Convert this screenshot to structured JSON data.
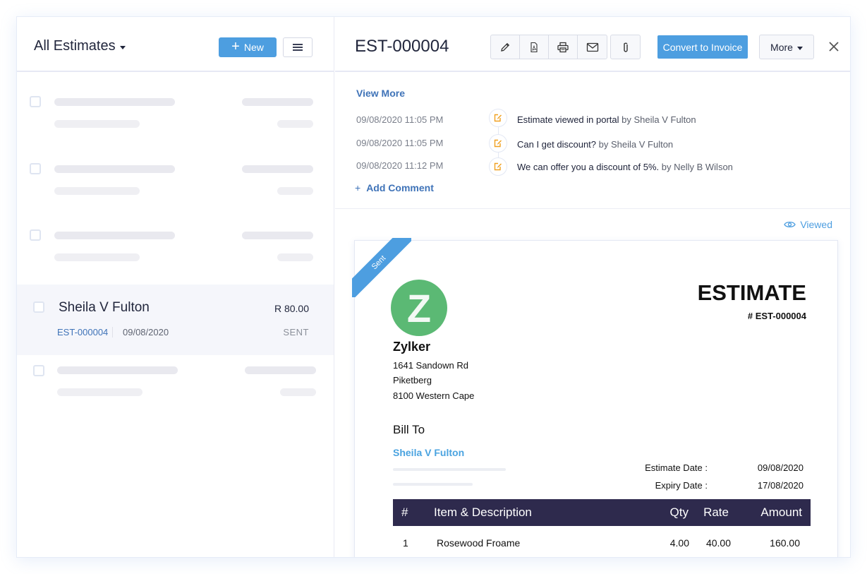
{
  "left_panel": {
    "title": "All Estimates",
    "new_button": "New",
    "new_icon": "plus-icon",
    "menu_icon": "hamburger-icon",
    "selected_item": {
      "customer": "Sheila V Fulton",
      "amount": "R 80.00",
      "estimate_number": "EST-000004",
      "date": "09/08/2020",
      "status": "SENT"
    }
  },
  "detail": {
    "estimate_number": "EST-000004",
    "toolbar": {
      "icons": [
        "edit-icon",
        "pdf-icon",
        "print-icon",
        "email-icon",
        "attachment-icon"
      ],
      "convert_button": "Convert to Invoice",
      "more_button": "More",
      "close_icon": "close-icon"
    },
    "activity": {
      "view_more": "View More",
      "entries": [
        {
          "time": "09/08/2020 11:05 PM",
          "text": "Estimate viewed in portal",
          "by": "by Sheila V Fulton"
        },
        {
          "time": "09/08/2020 11:05 PM",
          "text": "Can I get discount?",
          "by": "by Sheila V Fulton"
        },
        {
          "time": "09/08/2020 11:12 PM",
          "text": "We can offer you a discount of 5%.",
          "by": "by Nelly B Wilson"
        }
      ],
      "add_comment": "Add Comment",
      "add_comment_icon": "+"
    },
    "viewed_label": "Viewed",
    "document": {
      "ribbon": "Sent",
      "logo_letter": "Z",
      "org_name": "Zylker",
      "address": [
        "1641 Sandown Rd",
        "Piketberg",
        "8100 Western Cape"
      ],
      "doc_title": "ESTIMATE",
      "doc_number": "# EST-000004",
      "bill_to_label": "Bill To",
      "bill_to_name": "Sheila V Fulton",
      "estimate_date_label": "Estimate Date :",
      "estimate_date": "09/08/2020",
      "expiry_date_label": "Expiry Date :",
      "expiry_date": "17/08/2020",
      "table": {
        "headers": [
          "#",
          "Item & Description",
          "Qty",
          "Rate",
          "Amount"
        ],
        "rows": [
          {
            "num": "1",
            "item": "Rosewood Froame",
            "qty": "4.00",
            "rate": "40.00",
            "amount": "160.00"
          }
        ]
      }
    }
  },
  "colors": {
    "accent": "#4d9ee0",
    "link": "#3f73b8",
    "table_header": "#2e2a4d",
    "logo_green": "#5bb974",
    "activity_icon": "#f0a020"
  }
}
